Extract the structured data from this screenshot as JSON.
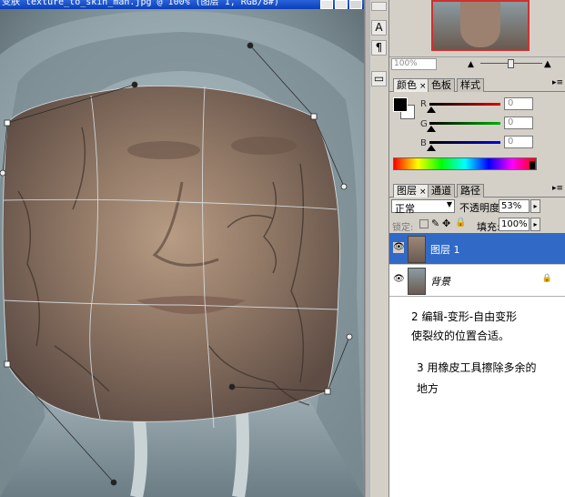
{
  "document": {
    "title": "变肤 texture_to_skin_man.jpg @ 100% (图层 1, RGB/8#)"
  },
  "navigator": {
    "zoom": "100%"
  },
  "dock": {
    "buttons": [
      "A",
      "¶",
      "▭"
    ]
  },
  "color_panel": {
    "tabs": [
      "颜色",
      "色板",
      "样式"
    ],
    "channels": [
      {
        "label": "R",
        "value": "0",
        "color": "#d40000"
      },
      {
        "label": "G",
        "value": "0",
        "color": "#00a000"
      },
      {
        "label": "B",
        "value": "0",
        "color": "#0000c8"
      }
    ]
  },
  "layers_panel": {
    "tabs": [
      "图层",
      "通道",
      "路径"
    ],
    "blend_mode": "正常",
    "opacity_label": "不透明度:",
    "opacity": "53%",
    "lock_label": "锁定:",
    "fill_label": "填充:",
    "fill": "100%",
    "layers": [
      {
        "name": "图层 1",
        "selected": true
      },
      {
        "name": "背景",
        "selected": false,
        "locked": true
      }
    ]
  },
  "instructions": {
    "step2_line1": "2  编辑-变形-自由变形",
    "step2_line2": "使裂纹的位置合适。",
    "step3_line1": "3 用橡皮工具擦除多余的",
    "step3_line2": "地方"
  }
}
